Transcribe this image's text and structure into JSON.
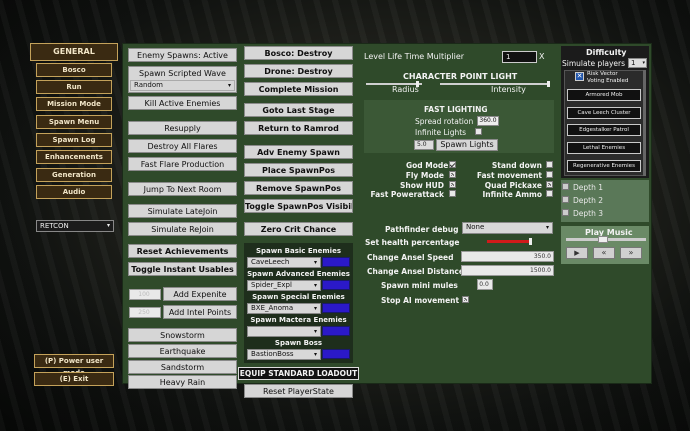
{
  "left_nav": {
    "header": "GENERAL",
    "items": [
      "Bosco",
      "Run",
      "Mission Mode",
      "Spawn Menu",
      "Spawn Log",
      "Enhancements",
      "Generation",
      "Audio"
    ],
    "retcon_dropdown": "RETCON",
    "power_user": "(P) Power user mode",
    "exit": "(E) Exit"
  },
  "col1": {
    "enemy_spawns": "Enemy Spawns: Active",
    "spawn_scripted_wave": "Spawn Scripted Wave",
    "wave_select": "Random",
    "kill_active_enemies": "Kill Active Enemies",
    "resupply": "Resupply",
    "destroy_all_flares": "Destroy All Flares",
    "fast_flare_production": "Fast Flare Production",
    "jump_next_room": "Jump To Next Room",
    "simulate_latejoin": "Simulate LateJoin",
    "simulate_rejoin": "Simulate ReJoin",
    "reset_achievements": "Reset Achievements",
    "toggle_instant_usables": "Toggle Instant Usables",
    "expenite_value": "100",
    "add_expenite": "Add Expenite",
    "intel_value": "250",
    "add_intel_points": "Add Intel Points",
    "snowstorm": "Snowstorm",
    "earthquake": "Earthquake",
    "sandstorm": "Sandstorm",
    "heavy_rain": "Heavy Rain"
  },
  "col2": {
    "bosco_destroy": "Bosco: Destroy",
    "drone_destroy": "Drone: Destroy",
    "complete_mission": "Complete Mission",
    "goto_last_stage": "Goto Last Stage",
    "return_ramrod": "Return to Ramrod",
    "adv_enemy_spawn": "Adv Enemy Spawn",
    "place_spawnpos": "Place SpawnPos",
    "remove_spawnpos": "Remove SpawnPos",
    "toggle_spawnpos_vis": "Toggle SpawnPos Visibility",
    "zero_crit_chance": "Zero Crit Chance",
    "spawn_basic": "Spawn Basic Enemies",
    "spawn_basic_val": "CaveLeech",
    "spawn_advanced": "Spawn Advanced Enemies",
    "spawn_advanced_val": "Spider_Expl",
    "spawn_special": "Spawn Special Enemies",
    "spawn_special_val": "BXE_Anoma",
    "spawn_mactera": "Spawn Mactera Enemies",
    "spawn_mactera_val": "",
    "spawn_boss": "Spawn Boss",
    "spawn_boss_val": "BastionBoss",
    "equip_loadout": "EQUIP STANDARD LOADOUT",
    "reset_playerstate": "Reset PlayerState"
  },
  "main": {
    "level_life_time": "Level Life Time Multiplier",
    "level_life_value": "1",
    "level_life_x": "X",
    "char_point_light": "CHARACTER POINT LIGHT",
    "radius": "Radius",
    "intensity": "Intensity",
    "fast_lighting": "FAST LIGHTING",
    "spread_rotation": "Spread rotation",
    "spread_value": "360.0",
    "infinite_lights": "Infinite Lights",
    "spawn_lights_value": "5.0",
    "spawn_lights": "Spawn Lights",
    "god_mode": "God Mode",
    "fly_mode": "Fly Mode",
    "show_hud": "Show HUD",
    "fast_powerattack": "Fast Powerattack",
    "stand_down": "Stand down",
    "fast_movement": "Fast movement",
    "quad_pickaxe": "Quad Pickaxe",
    "infinite_ammo": "Infinite Ammo",
    "pathfinder_debug": "Pathfinder debug",
    "pathfinder_value": "None",
    "set_health_pct": "Set health percentage",
    "change_ansel_speed": "Change Ansel Speed",
    "ansel_speed_value": "350.0",
    "change_ansel_distance": "Change Ansel Distance",
    "ansel_distance_value": "1500.0",
    "spawn_mini_mules": "Spawn mini mules",
    "mini_mules_value": "0.0",
    "stop_ai_movement": "Stop AI movement"
  },
  "difficulty": {
    "title": "Difficulty",
    "simulate_players": "Simulate players",
    "players_value": "1",
    "risk_vector_1": "Risk Vector",
    "risk_vector_2": "Voting Enabled",
    "options": [
      "Armored Mob",
      "Cave Leech Cluster",
      "Edgestalker Patrol",
      "Lethal Enemies",
      "Regenerative Enemies"
    ],
    "depths": [
      "Depth 1",
      "Depth 2",
      "Depth 3"
    ]
  },
  "music": {
    "title": "Play Music",
    "play": "▶",
    "prev": "«",
    "next": "»"
  },
  "colors": {
    "panel_green": "#2f4a2a",
    "nav_gold": "#c4a25a",
    "health_bar": "#d11a1a",
    "spawn_blue": "#2b19c8"
  }
}
